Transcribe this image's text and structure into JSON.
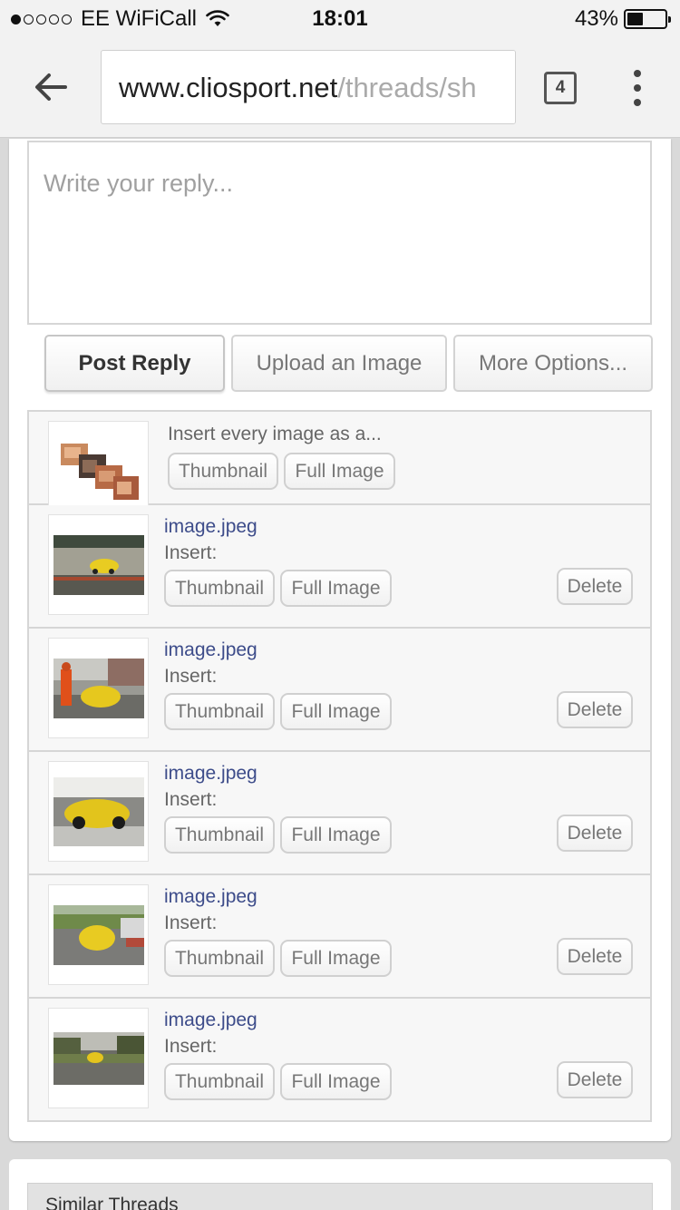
{
  "status_bar": {
    "carrier": "EE WiFiCall",
    "time": "18:01",
    "battery_percent": "43%",
    "battery_level": 0.43,
    "signal_bars": 1,
    "signal_total": 5
  },
  "browser": {
    "url_host": "www.cliosport.net",
    "url_path": "/threads/sh",
    "tab_count": "4",
    "icons": [
      "back-arrow-icon",
      "tabs-icon",
      "overflow-menu-icon",
      "wifi-icon",
      "battery-icon"
    ]
  },
  "reply": {
    "placeholder": "Write your reply..."
  },
  "actions": {
    "post_reply": "Post Reply",
    "upload_image": "Upload an Image",
    "more_options": "More Options..."
  },
  "insert_all": {
    "label": "Insert every image as a...",
    "thumbnail": "Thumbnail",
    "full_image": "Full Image"
  },
  "attachments": [
    {
      "name": "image.jpeg",
      "insert_label": "Insert:",
      "thumbnail": "Thumbnail",
      "full_image": "Full Image",
      "delete": "Delete"
    },
    {
      "name": "image.jpeg",
      "insert_label": "Insert:",
      "thumbnail": "Thumbnail",
      "full_image": "Full Image",
      "delete": "Delete"
    },
    {
      "name": "image.jpeg",
      "insert_label": "Insert:",
      "thumbnail": "Thumbnail",
      "full_image": "Full Image",
      "delete": "Delete"
    },
    {
      "name": "image.jpeg",
      "insert_label": "Insert:",
      "thumbnail": "Thumbnail",
      "full_image": "Full Image",
      "delete": "Delete"
    },
    {
      "name": "image.jpeg",
      "insert_label": "Insert:",
      "thumbnail": "Thumbnail",
      "full_image": "Full Image",
      "delete": "Delete"
    }
  ],
  "similar_threads": {
    "title": "Similar Threads"
  }
}
